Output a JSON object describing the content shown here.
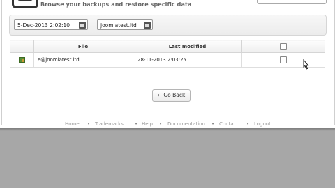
{
  "header": {
    "subtitle": "Browse your backups and restore specific data"
  },
  "filters": {
    "date_value": "5-Dec-2013 2:02:10",
    "account_value": "joomlatest.ltd"
  },
  "table": {
    "columns": [
      "",
      "File",
      "Last modified",
      ""
    ],
    "rows": [
      {
        "file": "e@joomlatest.ltd",
        "modified": "28-11-2013 2:03:25"
      }
    ]
  },
  "actions": {
    "back_label": "← Go Back"
  },
  "footer": {
    "links": [
      "Home",
      "Trademarks",
      "Help",
      "Documentation",
      "Contact",
      "Logout"
    ]
  },
  "icons": {
    "file_row": "mail-file-icon",
    "calendar": "calendar-icon"
  }
}
